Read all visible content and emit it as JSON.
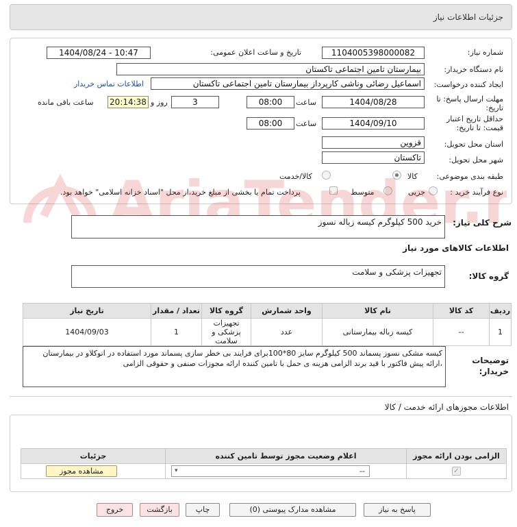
{
  "page": {
    "title": "جزئیات اطلاعات نیاز",
    "watermark": "AriaTender.neT"
  },
  "header": {
    "need_number_label": "شماره نیاز:",
    "need_number": "1104005398000082",
    "announce_label": "تاریخ و ساعت اعلان عمومی:",
    "announce_value": "1404/08/24 - 10:47",
    "buyer_org_label": "نام دستگاه خریدار:",
    "buyer_org": "بیمارستان تامین اجتماعی تاکستان",
    "creator_label": "ایجاد کننده درخواست:",
    "creator": "اسماعیل رضائی وناشی کارپرداز بیمارستان تامین اجتماعی تاکستان",
    "contact_link": "اطلاعات تماس خریدار",
    "deadline_label": "مهلت ارسال پاسخ: تا تاریخ:",
    "deadline_date": "1404/08/28",
    "time_word": "ساعت",
    "deadline_time": "08:00",
    "days_count": "3",
    "days_word": "روز و",
    "remaining_time": "20:14:38",
    "remaining_label": "ساعت باقی مانده",
    "validity_label": "حداقل تاریخ اعتبار قیمت: تا تاریخ:",
    "validity_date": "1404/09/10",
    "validity_time": "08:00",
    "province_label": "استان محل تحویل:",
    "province": "قزوین",
    "city_label": "شهر محل تحویل:",
    "city": "تاکستان",
    "category_label": "طبقه بندی موضوعی:",
    "category_options": [
      "کالا",
      "کالا/خدمت"
    ],
    "category_selected": "کالا",
    "purchase_label": "نوع فرآیند خرید :",
    "purchase_options": [
      "جزیی",
      "متوسط"
    ],
    "purchase_note": "پرداخت تمام یا بخشی از مبلغ خرید،از محل \"اسناد خزانه اسلامی\" خواهد بود."
  },
  "summary": {
    "label": "شرح کلی نیاز:",
    "value": "خرید 500 کیلوگرم کیسه زباله نسوز"
  },
  "goods": {
    "section_title": "اطلاعات کالاهای مورد نیاز",
    "group_label": "گروه کالا:",
    "group_value": "تجهیزات پزشکی و سلامت",
    "columns": [
      "ردیف",
      "کد کالا",
      "نام کالا",
      "واحد شمارش",
      "گروه کالا",
      "تعداد / مقدار",
      "تاریخ نیاز"
    ],
    "rows": [
      [
        "1",
        "--",
        "کیسه زباله بیمارستانی",
        "عدد",
        "تجهیزات پزشکی و سلامت",
        "1",
        "1404/09/03"
      ]
    ]
  },
  "buyer_notes": {
    "label": "توضیحات خریدار:",
    "value": "کیسه مشکی نسوز پسماند 500 کیلوگرم سایز 80*100برای فرایند بی خطر سازی پسماند مورد استفاده در اتوکلاو در بیمارستان ،ارائه پیش فاکتور با قید برند الزامی هزینه ی حمل با تامین کننده ارائه مجوزات صنفی و حقوقی الزامی"
  },
  "permits": {
    "section_title": "اطلاعات مجوزهای ارائه خدمت / کالا",
    "columns": [
      "الزامی بودن ارائه مجوز",
      "اعلام وضعیت مجوز توسط تامین کننده",
      "جزئیات"
    ],
    "select_value": "--",
    "view_button": "مشاهده مجوز"
  },
  "actions": {
    "reply": "پاسخ به نیاز",
    "view_docs": "مشاهده مدارک پیوستی (0)",
    "print": "چاپ",
    "back": "بازگشت",
    "exit": "خروج"
  },
  "colors": {
    "link": "#1a4fb3",
    "timer_bg": "#ffffcc",
    "header_bg": "#e6e6e6",
    "watermark": "#d02020"
  }
}
